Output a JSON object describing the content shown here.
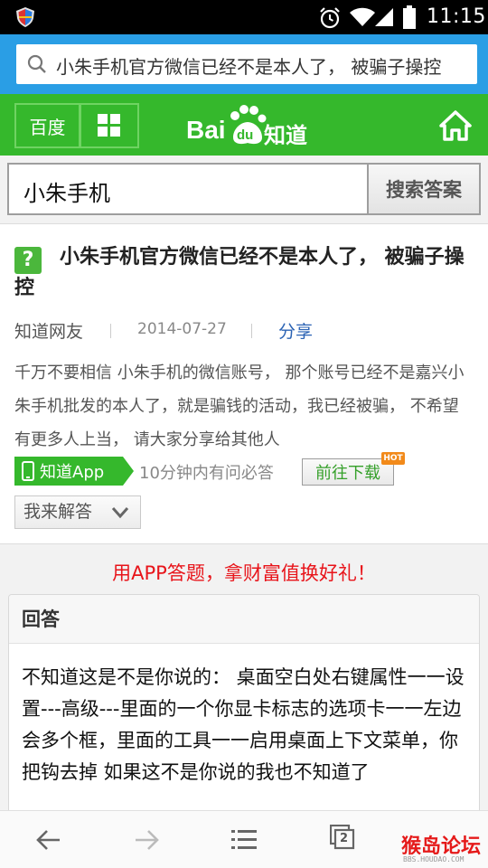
{
  "status_bar": {
    "time": "11:15",
    "icons": [
      "shield-icon",
      "alarm-icon",
      "wifi-icon",
      "signal-icon",
      "battery-icon"
    ]
  },
  "url_bar": {
    "text": "小朱手机官方微信已经不是本人了， 被骗子操控"
  },
  "header": {
    "baidu_label": "百度",
    "logo_text": "Bai",
    "logo_paw_text": "du",
    "logo_zhidao": "知道",
    "colors": {
      "green": "#35b82c",
      "blue": "#2a9ee5"
    }
  },
  "search": {
    "query": "小朱手机",
    "button_label": "搜索答案"
  },
  "question": {
    "icon": "?",
    "title": "小朱手机官方微信已经不是本人了， 被骗子操控",
    "author": "知道网友",
    "date": "2014-07-27",
    "share_label": "分享",
    "body": "千万不要相信 小朱手机的微信账号， 那个账号已经不是嘉兴小朱手机批发的本人了，就是骗钱的活动，我已经被骗， 不希望有更多人上当， 请大家分享给其他人"
  },
  "app_promo": {
    "badge_label": "知道App",
    "hint": "10分钟内有问必答",
    "download_label": "前往下载",
    "hot_label": "HOT",
    "answer_button": "我来解答"
  },
  "promo_banner": "用APP答题，拿财富值换好礼！",
  "answer": {
    "header": "回答",
    "body": "不知道这是不是你说的： 桌面空白处右键属性一一设置---高级---里面的一个你显卡标志的选项卡一一左边会多个框，里面的工具一一启用桌面上下文菜单，你把钩去掉 如果这不是你说的我也不知道了"
  },
  "bottom_nav": {
    "tab_count": "2",
    "watermark": "猴岛论坛",
    "watermark_sub": "BBS.HOUDAO.COM"
  }
}
